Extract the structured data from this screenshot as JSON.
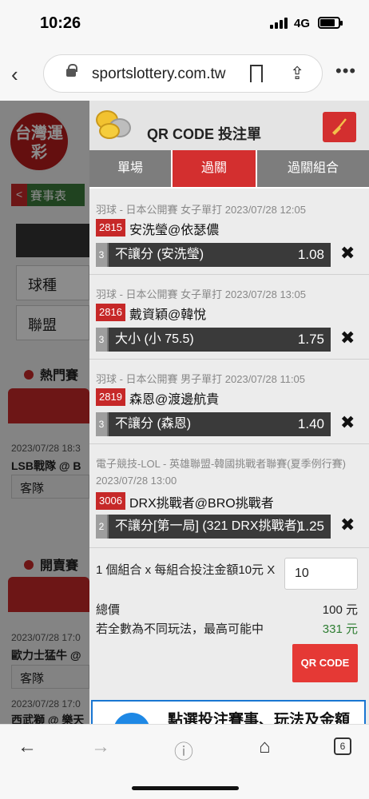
{
  "status": {
    "time": "10:26",
    "network": "4G"
  },
  "browser": {
    "url": "sportslottery.com.tw",
    "tab_count": "6"
  },
  "background_page": {
    "logo_text": "台灣運彩",
    "tab_label": "賽事表",
    "fields": [
      "球種",
      "聯盟"
    ],
    "sections": [
      "熱門賽",
      "開賣賽"
    ],
    "items": [
      {
        "date": "2023/07/28 18:3",
        "teams": "LSB戰隊 @ B",
        "side": "客隊"
      },
      {
        "date": "2023/07/28 17:0",
        "teams": "歐力士猛牛 @",
        "side": "客隊"
      },
      {
        "date": "2023/07/28 17:0",
        "teams": "西武獅 @ 樂天"
      }
    ]
  },
  "panel": {
    "title": "QR CODE 投注單",
    "tabs": [
      {
        "label": "單場",
        "active": false
      },
      {
        "label": "過關",
        "active": true
      },
      {
        "label": "過關組合",
        "active": false
      }
    ],
    "bets": [
      {
        "league": "羽球 - 日本公開賽 女子單打 2023/07/28 12:05",
        "code": "2815",
        "teams": "安洗瑩@依瑟儂",
        "num": "3",
        "pick": "不讓分 (安洗瑩)",
        "odds": "1.08"
      },
      {
        "league": "羽球 - 日本公開賽 女子單打 2023/07/28 13:05",
        "code": "2816",
        "teams": "戴資穎@韓悅",
        "num": "3",
        "pick": "大小 (小 75.5)",
        "odds": "1.75"
      },
      {
        "league": "羽球 - 日本公開賽 男子單打 2023/07/28 11:05",
        "code": "2819",
        "teams": "森恩@渡邊航貴",
        "num": "3",
        "pick": "不讓分 (森恩)",
        "odds": "1.40"
      },
      {
        "league": "電子競技-LOL - 英雄聯盟-韓國挑戰者聯賽(夏季例行賽)",
        "league2": "2023/07/28 13:00",
        "code": "3006",
        "teams": "DRX挑戰者@BRO挑戰者",
        "num": "2",
        "pick": "不讓分[第一局] (321 DRX挑戰者)",
        "odds": "1.25"
      }
    ],
    "summary": {
      "combo_text": "1 個組合 x 每組合投注金額10元 X",
      "amount": "10",
      "total_label": "總價",
      "total_value": "100 元",
      "max_label": "若全數為不同玩法，最高可能中",
      "max_value": "331 元",
      "qr_button": "QR CODE"
    },
    "promo_text": "點選投注賽事、玩法及金額"
  },
  "colors": {
    "accent": "#d32f2f",
    "tab_inactive": "#7d7d7d",
    "win": "#2e7d32",
    "odds_bg": "#3a3a3a"
  }
}
